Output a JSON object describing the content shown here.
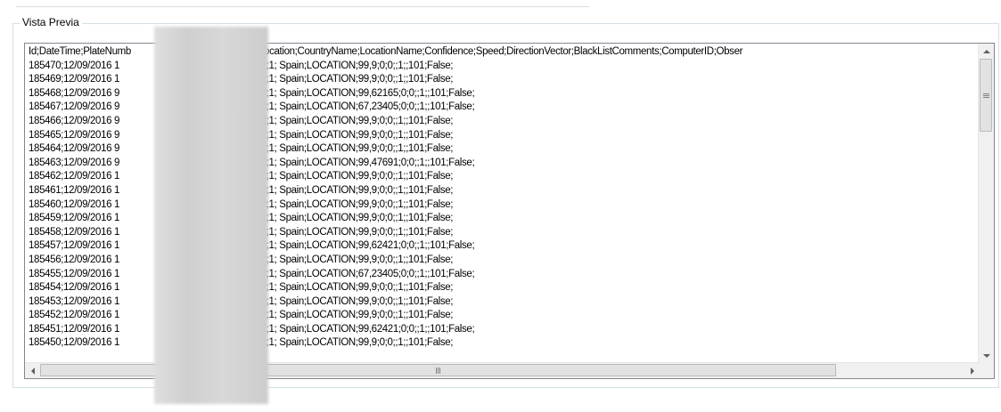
{
  "groupbox": {
    "title": "Vista Previa"
  },
  "preview": {
    "lines": [
      "Id;DateTime;PlateNumb                     ra;CameraName;Location;CountryName;LocationName;Confidence;Speed;DirectionVector;BlackListComments;ComputerID;Obser",
      "185470;12/09/2016 1                       amera 2;2;Camera 2;1; Spain;LOCATION;99,9;0;0;;1;;101;False;",
      "185469;12/09/2016 1                       amera 2;2;Camera 2;1; Spain;LOCATION;99,9;0;0;;1;;101;False;",
      "185468;12/09/2016 9                       amera 2;2;Camera 2;1; Spain;LOCATION;99,62165;0;0;;1;;101;False;",
      "185467;12/09/2016 9                       amera 2;2;Camera 2;1; Spain;LOCATION;67,23405;0;0;;1;;101;False;",
      "185466;12/09/2016 9                       amera 2;2;Camera 2;1; Spain;LOCATION;99,9;0;0;;1;;101;False;",
      "185465;12/09/2016 9                       amera 2;2;Camera 2;1; Spain;LOCATION;99,9;0;0;;1;;101;False;",
      "185464;12/09/2016 9                       amera 2;2;Camera 2;1; Spain;LOCATION;99,9;0;0;;1;;101;False;",
      "185463;12/09/2016 9                       amera 2;2;Camera 2;1; Spain;LOCATION;99,47691;0;0;;1;;101;False;",
      "185462;12/09/2016 1                       amera 2;2;Camera 2;1; Spain;LOCATION;99,9;0;0;;1;;101;False;",
      "185461;12/09/2016 1                       amera 2;2;Camera 2;1; Spain;LOCATION;99,9;0;0;;1;;101;False;",
      "185460;12/09/2016 1                       amera 2;2;Camera 2;1; Spain;LOCATION;99,9;0;0;;1;;101;False;",
      "185459;12/09/2016 1                       amera 2;2;Camera 2;1; Spain;LOCATION;99,9;0;0;;1;;101;False;",
      "185458;12/09/2016 1                       amera 2;2;Camera 2;1; Spain;LOCATION;99,9;0;0;;1;;101;False;",
      "185457;12/09/2016 1                       amera 2;2;Camera 2;1; Spain;LOCATION;99,62421;0;0;;1;;101;False;",
      "185456;12/09/2016 1                       amera 2;2;Camera 2;1; Spain;LOCATION;99,9;0;0;;1;;101;False;",
      "185455;12/09/2016 1                       amera 2;2;Camera 2;1; Spain;LOCATION;67,23405;0;0;;1;;101;False;",
      "185454;12/09/2016 1                       amera 2;2;Camera 2;1; Spain;LOCATION;99,9;0;0;;1;;101;False;",
      "185453;12/09/2016 1                       amera 2;2;Camera 2;1; Spain;LOCATION;99,9;0;0;;1;;101;False;",
      "185452;12/09/2016 1                       amera 2;2;Camera 2;1; Spain;LOCATION;99,9;0;0;;1;;101;False;",
      "185451;12/09/2016 1                       amera 2;2;Camera 2;1; Spain;LOCATION;99,62421;0;0;;1;;101;False;",
      "185450;12/09/2016 1                       amera 2;2;Camera 2;1; Spain;LOCATION;99,9;0;0;;1;;101;False;"
    ]
  },
  "scrollbars": {
    "vertical": {
      "position": 0.0,
      "up_icon": "arrow-up-icon",
      "down_icon": "arrow-down-icon"
    },
    "horizontal": {
      "position": 0.0,
      "left_icon": "arrow-left-icon",
      "right_icon": "arrow-right-icon"
    }
  },
  "colors": {
    "groupbox_border": "#d5dfe5",
    "textbox_border": "#828790",
    "scrollbar_bg": "#f0f0f0"
  }
}
